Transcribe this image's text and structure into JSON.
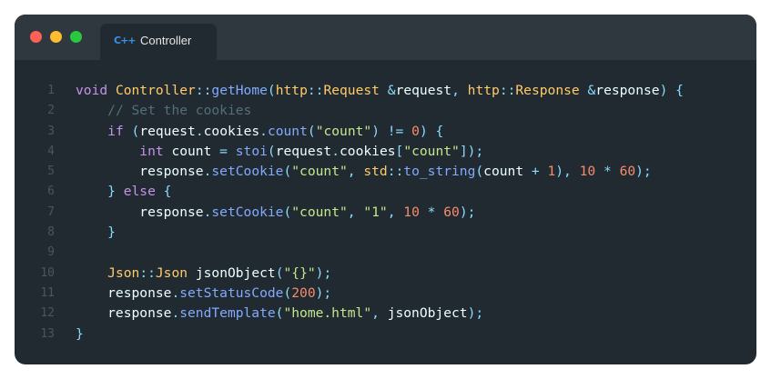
{
  "window": {
    "colors": {
      "background": "#212a31",
      "titlebar": "#2f383f",
      "close": "#ff5f57",
      "minimize": "#febc2e",
      "maximize": "#28c840"
    }
  },
  "tab": {
    "icon": "C++",
    "icon_name": "cpp-language-icon",
    "label": "Controller"
  },
  "code": {
    "lines": [
      {
        "num": "1",
        "tokens": [
          [
            "kw",
            "void"
          ],
          [
            "id",
            " "
          ],
          [
            "cls",
            "Controller"
          ],
          [
            "op",
            "::"
          ],
          [
            "fn",
            "getHome"
          ],
          [
            "op",
            "("
          ],
          [
            "ns",
            "http"
          ],
          [
            "op",
            "::"
          ],
          [
            "cls",
            "Request"
          ],
          [
            "id",
            " "
          ],
          [
            "op",
            "&"
          ],
          [
            "id",
            "request"
          ],
          [
            "op",
            ", "
          ],
          [
            "ns",
            "http"
          ],
          [
            "op",
            "::"
          ],
          [
            "cls",
            "Response"
          ],
          [
            "id",
            " "
          ],
          [
            "op",
            "&"
          ],
          [
            "id",
            "response"
          ],
          [
            "op",
            ") {"
          ]
        ]
      },
      {
        "num": "2",
        "tokens": [
          [
            "id",
            "    "
          ],
          [
            "cm",
            "// Set the cookies"
          ]
        ]
      },
      {
        "num": "3",
        "tokens": [
          [
            "id",
            "    "
          ],
          [
            "kw",
            "if"
          ],
          [
            "id",
            " "
          ],
          [
            "op",
            "("
          ],
          [
            "id",
            "request"
          ],
          [
            "op",
            "."
          ],
          [
            "id",
            "cookies"
          ],
          [
            "op",
            "."
          ],
          [
            "fn",
            "count"
          ],
          [
            "op",
            "("
          ],
          [
            "str",
            "\"count\""
          ],
          [
            "op",
            ") != "
          ],
          [
            "num",
            "0"
          ],
          [
            "op",
            ") {"
          ]
        ]
      },
      {
        "num": "4",
        "tokens": [
          [
            "id",
            "        "
          ],
          [
            "kw",
            "int"
          ],
          [
            "id",
            " count "
          ],
          [
            "op",
            "= "
          ],
          [
            "fn",
            "stoi"
          ],
          [
            "op",
            "("
          ],
          [
            "id",
            "request"
          ],
          [
            "op",
            "."
          ],
          [
            "id",
            "cookies"
          ],
          [
            "op",
            "["
          ],
          [
            "str",
            "\"count\""
          ],
          [
            "op",
            "]);"
          ]
        ]
      },
      {
        "num": "5",
        "tokens": [
          [
            "id",
            "        response"
          ],
          [
            "op",
            "."
          ],
          [
            "fn",
            "setCookie"
          ],
          [
            "op",
            "("
          ],
          [
            "str",
            "\"count\""
          ],
          [
            "op",
            ", "
          ],
          [
            "ns",
            "std"
          ],
          [
            "op",
            "::"
          ],
          [
            "fn",
            "to_string"
          ],
          [
            "op",
            "("
          ],
          [
            "id",
            "count "
          ],
          [
            "op",
            "+ "
          ],
          [
            "num",
            "1"
          ],
          [
            "op",
            "), "
          ],
          [
            "num",
            "10"
          ],
          [
            "op",
            " * "
          ],
          [
            "num",
            "60"
          ],
          [
            "op",
            ");"
          ]
        ]
      },
      {
        "num": "6",
        "tokens": [
          [
            "id",
            "    "
          ],
          [
            "op",
            "} "
          ],
          [
            "kw",
            "else"
          ],
          [
            "op",
            " {"
          ]
        ]
      },
      {
        "num": "7",
        "tokens": [
          [
            "id",
            "        response"
          ],
          [
            "op",
            "."
          ],
          [
            "fn",
            "setCookie"
          ],
          [
            "op",
            "("
          ],
          [
            "str",
            "\"count\""
          ],
          [
            "op",
            ", "
          ],
          [
            "str",
            "\"1\""
          ],
          [
            "op",
            ", "
          ],
          [
            "num",
            "10"
          ],
          [
            "op",
            " * "
          ],
          [
            "num",
            "60"
          ],
          [
            "op",
            ");"
          ]
        ]
      },
      {
        "num": "8",
        "tokens": [
          [
            "id",
            "    "
          ],
          [
            "op",
            "}"
          ]
        ]
      },
      {
        "num": "9",
        "tokens": []
      },
      {
        "num": "10",
        "tokens": [
          [
            "id",
            "    "
          ],
          [
            "cls",
            "Json"
          ],
          [
            "op",
            "::"
          ],
          [
            "cls",
            "Json"
          ],
          [
            "id",
            " jsonObject"
          ],
          [
            "op",
            "("
          ],
          [
            "str",
            "\"{}\""
          ],
          [
            "op",
            ");"
          ]
        ]
      },
      {
        "num": "11",
        "tokens": [
          [
            "id",
            "    response"
          ],
          [
            "op",
            "."
          ],
          [
            "fn",
            "setStatusCode"
          ],
          [
            "op",
            "("
          ],
          [
            "num",
            "200"
          ],
          [
            "op",
            ");"
          ]
        ]
      },
      {
        "num": "12",
        "tokens": [
          [
            "id",
            "    response"
          ],
          [
            "op",
            "."
          ],
          [
            "fn",
            "sendTemplate"
          ],
          [
            "op",
            "("
          ],
          [
            "str",
            "\"home.html\""
          ],
          [
            "op",
            ", "
          ],
          [
            "id",
            "jsonObject"
          ],
          [
            "op",
            ");"
          ]
        ]
      },
      {
        "num": "13",
        "tokens": [
          [
            "op",
            "}"
          ]
        ]
      }
    ]
  }
}
